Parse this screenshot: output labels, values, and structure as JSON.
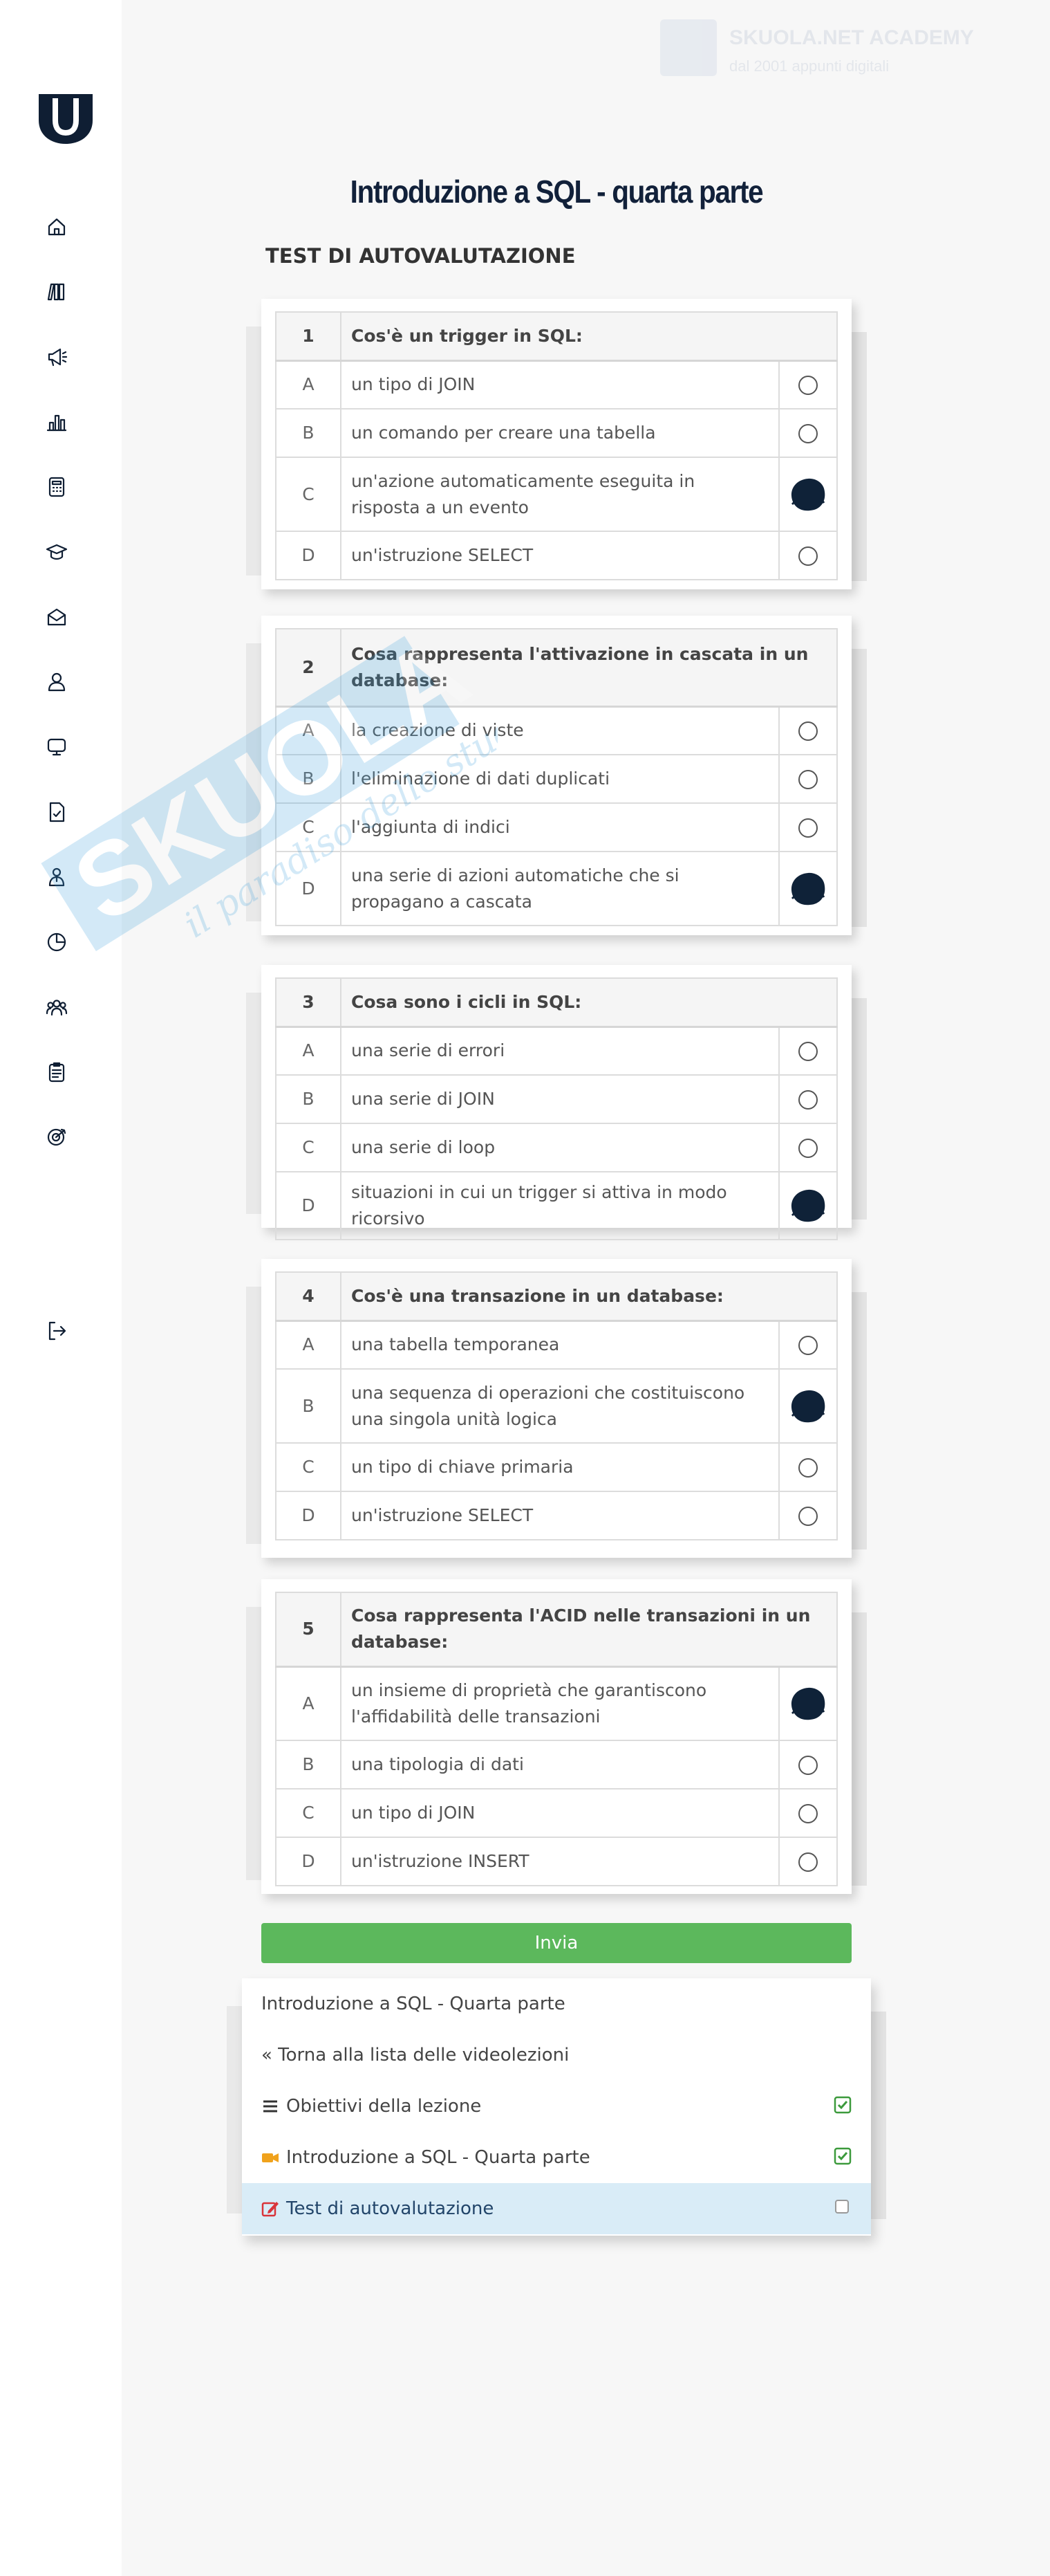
{
  "header": {
    "brand_line1": "SKUOLA.NET ACADEMY",
    "brand_line2": "dal 2001 appunti digitali"
  },
  "page": {
    "title": "Introduzione a SQL - quarta parte",
    "section": "TEST DI AUTOVALUTAZIONE"
  },
  "sidebar": {
    "items": [
      "home-icon",
      "books-icon",
      "megaphone-icon",
      "chart-icon",
      "calculator-icon",
      "graduation-cap-icon",
      "mail-icon",
      "user-icon",
      "monitor-icon",
      "document-icon",
      "teacher-icon",
      "pie-chart-icon",
      "users-icon",
      "clipboard-icon",
      "target-icon",
      "logout-icon"
    ]
  },
  "quiz": [
    {
      "num": "1",
      "question": "Cos'è un trigger in SQL:",
      "options": [
        {
          "letter": "A",
          "text": "un tipo di JOIN"
        },
        {
          "letter": "B",
          "text": "un comando per creare una tabella"
        },
        {
          "letter": "C",
          "text": "un'azione automaticamente eseguita in risposta a un evento"
        },
        {
          "letter": "D",
          "text": "un'istruzione SELECT"
        }
      ],
      "answer": "C"
    },
    {
      "num": "2",
      "question": "Cosa rappresenta l'attivazione in cascata in un database:",
      "options": [
        {
          "letter": "A",
          "text": "la creazione di viste"
        },
        {
          "letter": "B",
          "text": "l'eliminazione di dati duplicati"
        },
        {
          "letter": "C",
          "text": "l'aggiunta di indici"
        },
        {
          "letter": "D",
          "text": "una serie di azioni automatiche che si propagano a cascata"
        }
      ],
      "answer": "D"
    },
    {
      "num": "3",
      "question": "Cosa sono i cicli in SQL:",
      "options": [
        {
          "letter": "A",
          "text": "una serie di errori"
        },
        {
          "letter": "B",
          "text": "una serie di JOIN"
        },
        {
          "letter": "C",
          "text": "una serie di loop"
        },
        {
          "letter": "D",
          "text": "situazioni in cui un trigger si attiva in modo ricorsivo"
        }
      ],
      "answer": "D"
    },
    {
      "num": "4",
      "question": "Cos'è una transazione in un database:",
      "options": [
        {
          "letter": "A",
          "text": "una tabella temporanea"
        },
        {
          "letter": "B",
          "text": "una sequenza di operazioni che costituiscono una singola unità logica"
        },
        {
          "letter": "C",
          "text": "un tipo di chiave primaria"
        },
        {
          "letter": "D",
          "text": "un'istruzione SELECT"
        }
      ],
      "answer": "B"
    },
    {
      "num": "5",
      "question": "Cosa rappresenta l'ACID nelle transazioni in un database:",
      "options": [
        {
          "letter": "A",
          "text": "un insieme di proprietà che garantiscono l'affidabilità delle transazioni"
        },
        {
          "letter": "B",
          "text": "una tipologia di dati"
        },
        {
          "letter": "C",
          "text": "un tipo di JOIN"
        },
        {
          "letter": "D",
          "text": "un'istruzione INSERT"
        }
      ],
      "answer": "A"
    }
  ],
  "submit_label": "Invia",
  "lesson_panel": {
    "title": "Introduzione a SQL - Quarta parte",
    "back": "« Torna alla lista delle videolezioni",
    "items": [
      {
        "label": "Obiettivi della lezione",
        "icon": "list-icon",
        "checked": true
      },
      {
        "label": "Introduzione a SQL - Quarta parte",
        "icon": "video-icon",
        "checked": true
      },
      {
        "label": "Test di autovalutazione",
        "icon": "edit-icon",
        "checked": false
      }
    ]
  },
  "colors": {
    "accent_green": "#5cb85c",
    "navy": "#0f1e33",
    "active_row": "#d9ecf7"
  }
}
